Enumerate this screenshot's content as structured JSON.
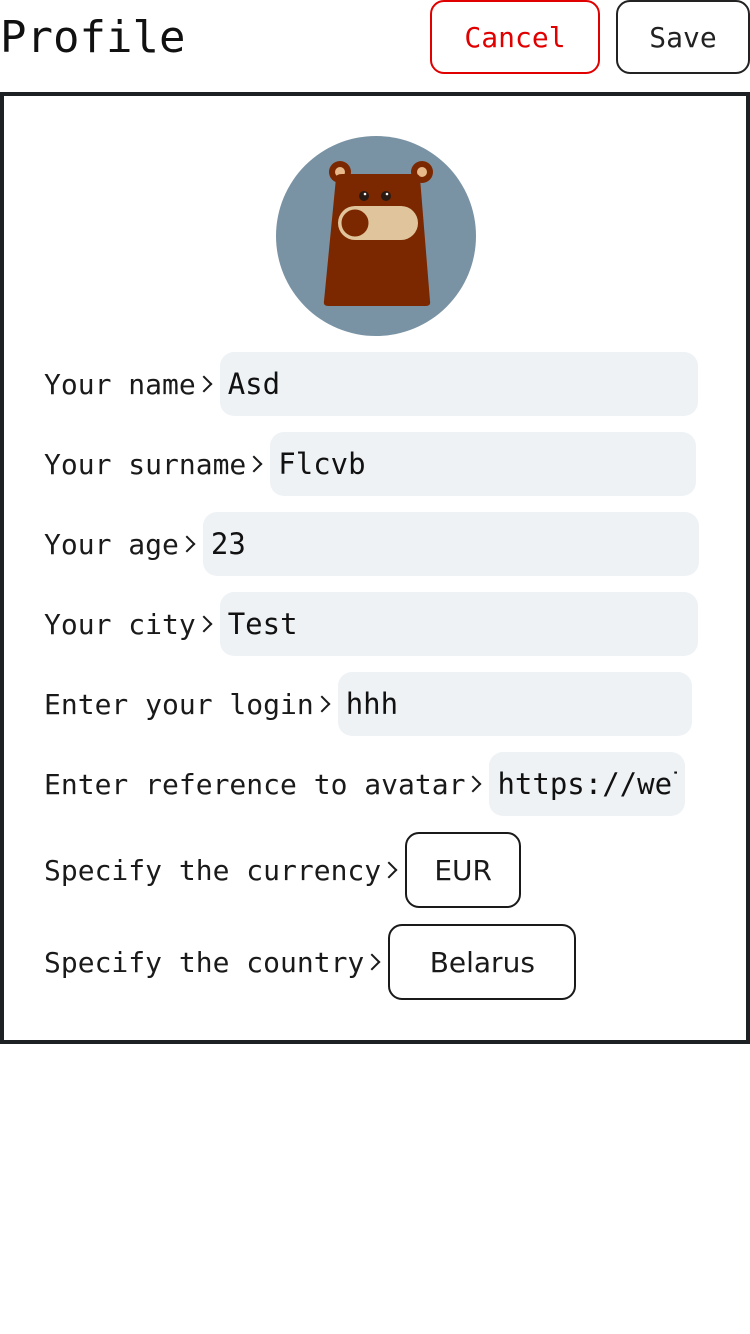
{
  "header": {
    "title": "Profile",
    "cancel_label": "Cancel",
    "save_label": "Save"
  },
  "form": {
    "name_label": "Your name",
    "name_value": "Asd",
    "surname_label": "Your surname",
    "surname_value": "Flcvb",
    "age_label": "Your age",
    "age_value": "23",
    "city_label": "Your city",
    "city_value": "Test",
    "login_label": "Enter your login",
    "login_value": "hhh",
    "avatar_label": "Enter reference to avatar",
    "avatar_value": "https://wel",
    "currency_label": "Specify the currency",
    "currency_value": "EUR",
    "country_label": "Specify the country",
    "country_value": "Belarus"
  },
  "colors": {
    "cancel": "#e00000",
    "avatar_bg": "#7a93a4",
    "bear_body": "#7b2800",
    "field_bg": "#eef2f5"
  },
  "icons": [
    "bear-avatar-icon",
    "chevron-right-icon"
  ]
}
